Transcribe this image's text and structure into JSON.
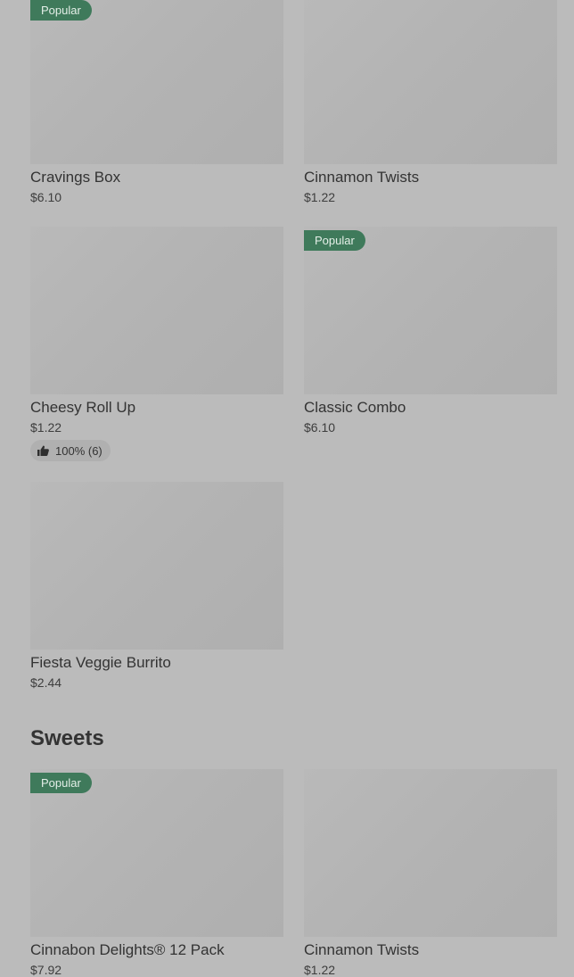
{
  "sections": [
    {
      "title": "",
      "items": [
        {
          "name": "Cravings Box",
          "price": "$6.10",
          "badge": "Popular"
        },
        {
          "name": "Cinnamon Twists",
          "price": "$1.22",
          "badge": ""
        },
        {
          "name": "Cheesy Roll Up",
          "price": "$1.22",
          "badge": "",
          "rating": "100% (6)"
        },
        {
          "name": "Classic Combo",
          "price": "$6.10",
          "badge": "Popular"
        },
        {
          "name": "Fiesta Veggie Burrito",
          "price": "$2.44",
          "badge": ""
        }
      ]
    },
    {
      "title": "Sweets",
      "items": [
        {
          "name": "Cinnabon Delights® 12 Pack",
          "price": "$7.92",
          "badge": "Popular"
        },
        {
          "name": "Cinnamon Twists",
          "price": "$1.22",
          "badge": ""
        }
      ]
    }
  ],
  "icons": {
    "rating": "thumbs-up-icon"
  },
  "colors": {
    "overlay_background": "#bbbbbb",
    "badge_background": "#3f7a5b",
    "badge_text": "#e4efe8"
  }
}
